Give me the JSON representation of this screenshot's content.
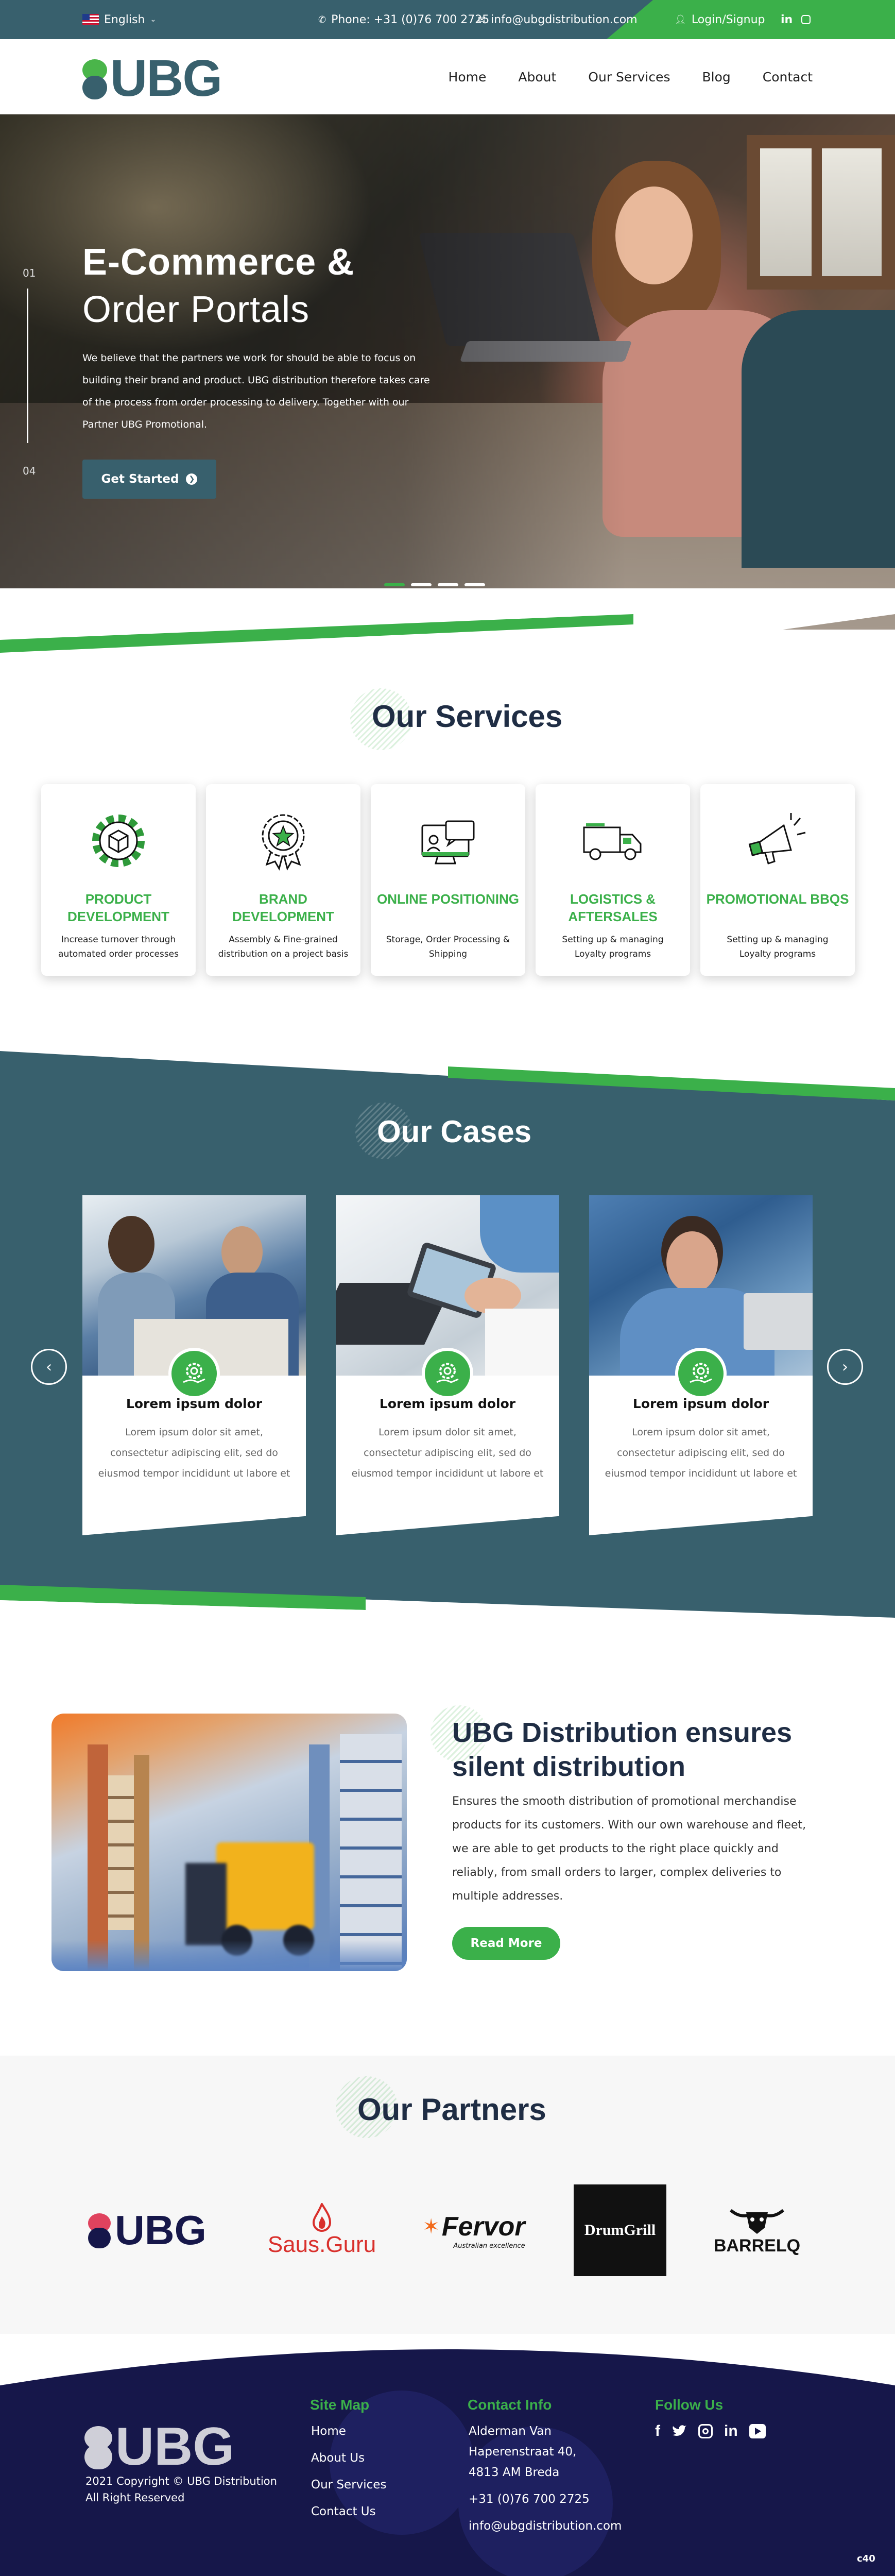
{
  "topbar": {
    "language": "English",
    "phone": "Phone: +31 (0)76 700 2725",
    "email": "info@ubgdistribution.com",
    "login": "Login/Signup",
    "social": [
      "linkedin-icon",
      "instagram-icon"
    ]
  },
  "header": {
    "logo_text": "UBG",
    "nav": [
      "Home",
      "About",
      "Our Services",
      "Blog",
      "Contact"
    ]
  },
  "hero": {
    "title_line1": "E-Commerce &",
    "title_line2": "Order Portals",
    "description": "We believe that the partners we work for should be able to focus on building their brand and product. UBG distribution therefore takes care of the process from order processing to delivery. Together with our Partner UBG Promotional.",
    "button": "Get Started",
    "slide_current": "01",
    "slide_total": "04",
    "active_dot": 0
  },
  "services": {
    "title": "Our Services",
    "items": [
      {
        "icon": "gear-box-icon",
        "title": "PRODUCT DEVELOPMENT",
        "desc": "Increase turnover through automated order processes"
      },
      {
        "icon": "award-star-icon",
        "title": "BRAND DEVELOPMENT",
        "desc": "Assembly & Fine-grained distribution on a project basis"
      },
      {
        "icon": "monitor-chat-icon",
        "title": "ONLINE POSITIONING",
        "desc": "Storage, Order Processing & Shipping"
      },
      {
        "icon": "truck-icon",
        "title": "LOGISTICS & AFTERSALES",
        "desc": "Setting up & managing Loyalty programs"
      },
      {
        "icon": "megaphone-icon",
        "title": "PROMOTIONAL BBQS",
        "desc": "Setting up & managing Loyalty programs"
      }
    ]
  },
  "cases": {
    "title": "Our Cases",
    "items": [
      {
        "icon": "gear-hand-icon",
        "title": "Lorem ipsum dolor",
        "text": "Lorem ipsum dolor sit amet, consectetur adipiscing elit, sed do eiusmod tempor incididunt ut labore et"
      },
      {
        "icon": "gear-hand-icon",
        "title": "Lorem ipsum dolor",
        "text": "Lorem ipsum dolor sit amet, consectetur adipiscing elit, sed do eiusmod tempor incididunt ut labore et"
      },
      {
        "icon": "gear-hand-icon",
        "title": "Lorem ipsum dolor",
        "text": "Lorem ipsum dolor sit amet, consectetur adipiscing elit, sed do eiusmod tempor incididunt ut labore et"
      }
    ]
  },
  "distribution": {
    "title": "UBG Distribution ensures silent distribution",
    "text": "Ensures the smooth distribution of promotional merchandise products for its customers. With our own warehouse and fleet, we are able to get products to the right place quickly and reliably, from small orders to larger, complex deliveries to multiple addresses.",
    "button": "Read More"
  },
  "partners": {
    "title": "Our Partners",
    "logos": [
      "UBG",
      "Saus.Guru",
      "Fervor",
      "Australian excellence",
      "DrumGrill",
      "BARRELQ"
    ]
  },
  "footer": {
    "logo_text": "UBG",
    "copyright": "2021 Copyright © UBG Distribution",
    "rights": "All Right Reserved",
    "sitemap_title": "Site Map",
    "sitemap": [
      "Home",
      "About Us",
      "Our Services",
      "Contact Us"
    ],
    "contact_title": "Contact Info",
    "address": [
      "Alderman Van",
      "Haperenstraat 40,",
      "4813 AM Breda"
    ],
    "phone": "+31 (0)76 700 2725",
    "email": "info@ubgdistribution.com",
    "follow_title": "Follow Us",
    "social": [
      "facebook-icon",
      "twitter-icon",
      "instagram-icon",
      "linkedin-icon",
      "youtube-icon"
    ],
    "credit": "c40"
  },
  "colors": {
    "teal": "#38606d",
    "green": "#3bb04a",
    "navy": "#16174a"
  }
}
